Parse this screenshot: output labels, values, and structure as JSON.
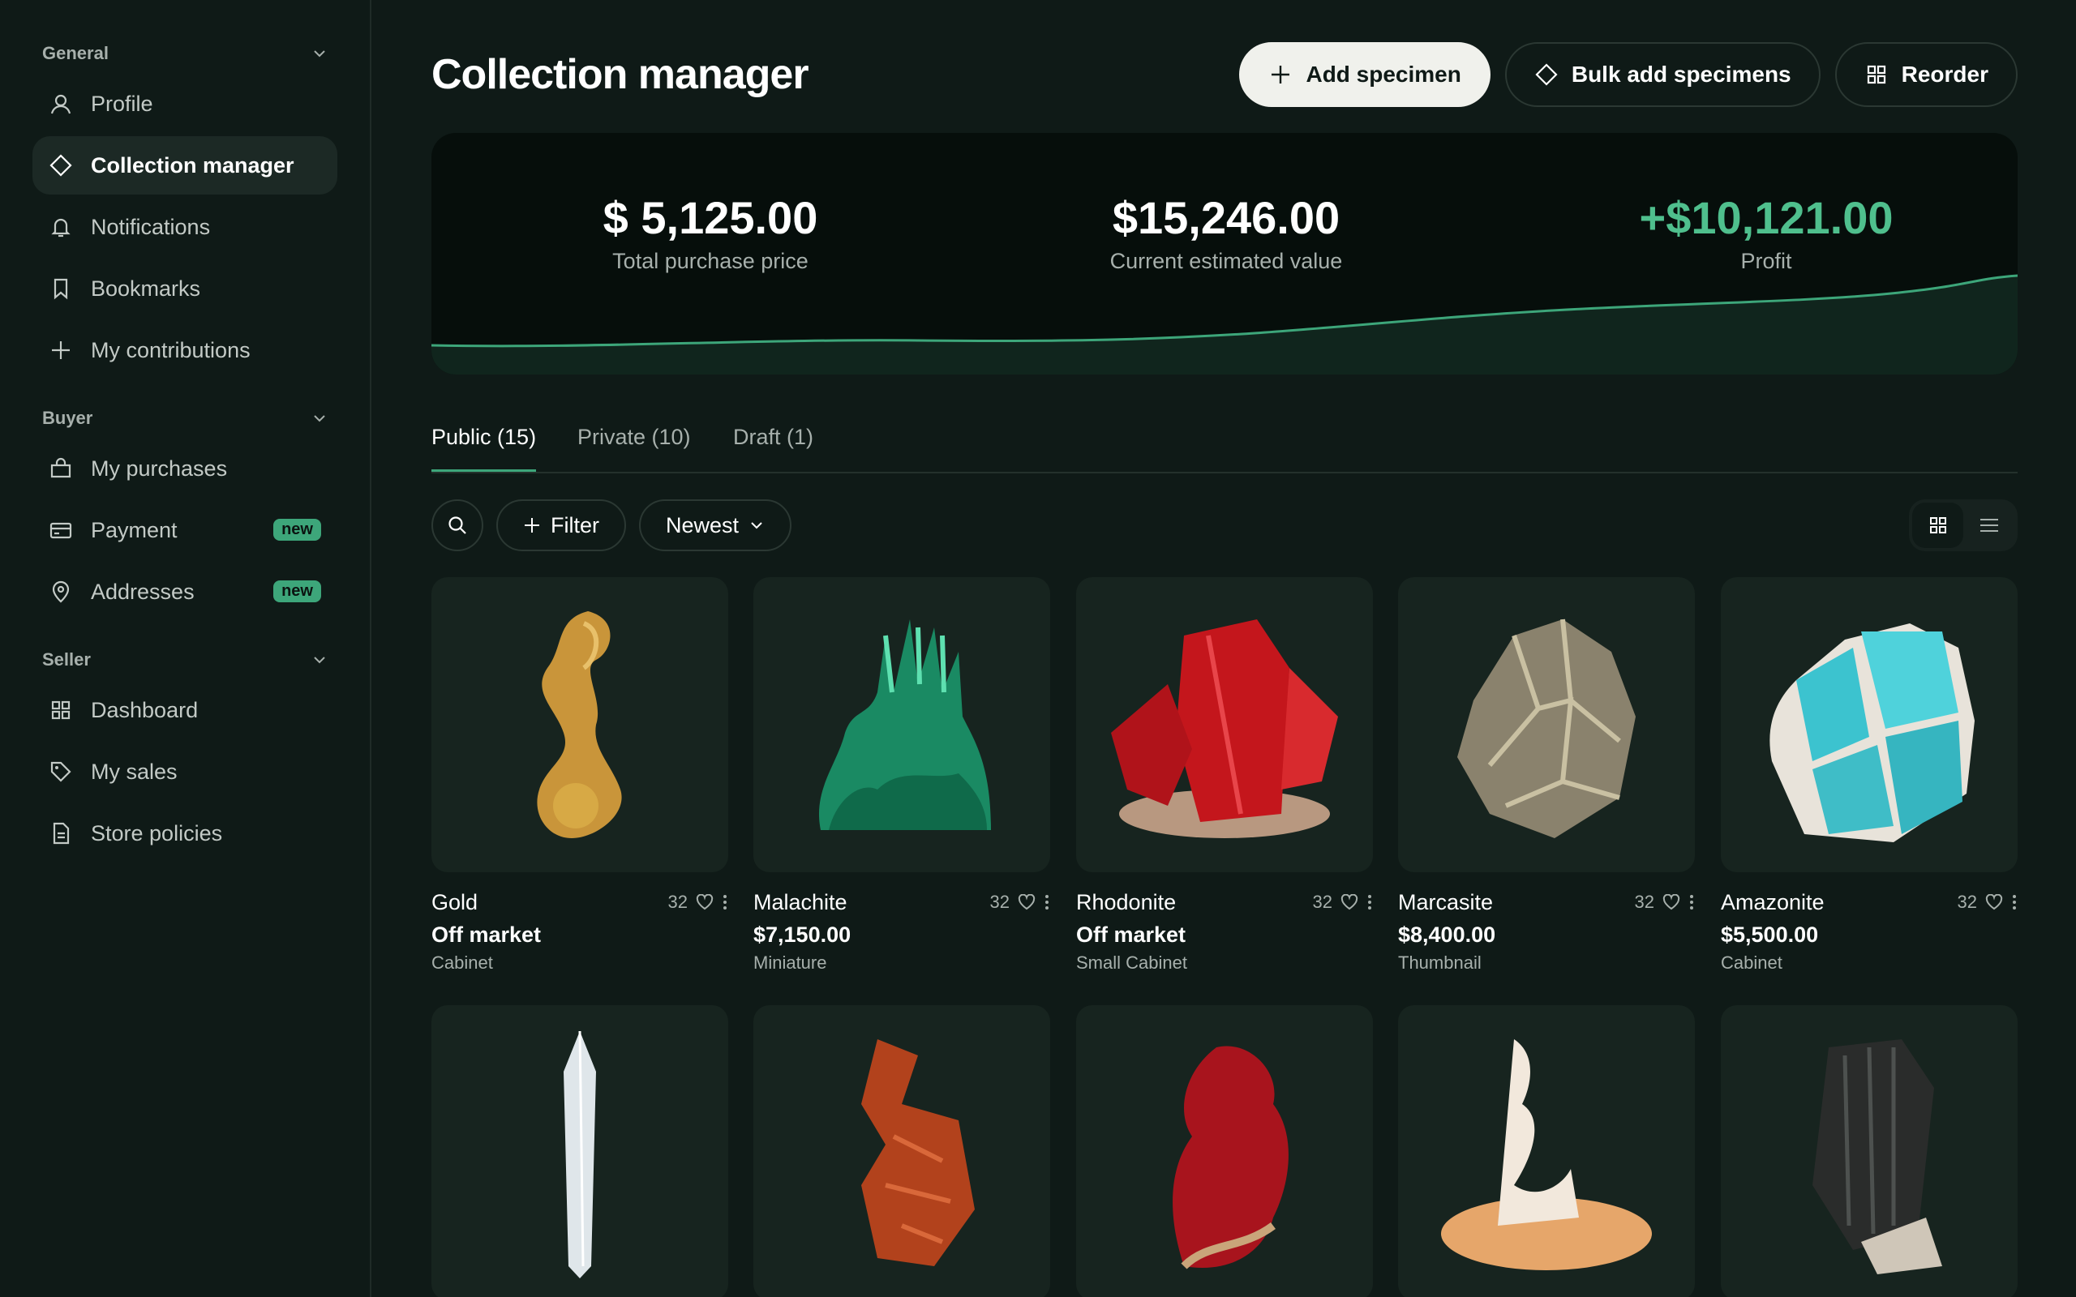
{
  "sidebar": {
    "sections": [
      {
        "title": "General",
        "items": [
          {
            "label": "Profile",
            "icon": "user-icon"
          },
          {
            "label": "Collection manager",
            "icon": "diamond-icon",
            "active": true
          },
          {
            "label": "Notifications",
            "icon": "bell-icon"
          },
          {
            "label": "Bookmarks",
            "icon": "bookmark-icon"
          },
          {
            "label": "My contributions",
            "icon": "plus-icon"
          }
        ]
      },
      {
        "title": "Buyer",
        "items": [
          {
            "label": "My purchases",
            "icon": "bag-icon"
          },
          {
            "label": "Payment",
            "icon": "card-icon",
            "badge": "new"
          },
          {
            "label": "Addresses",
            "icon": "pin-icon",
            "badge": "new"
          }
        ]
      },
      {
        "title": "Seller",
        "items": [
          {
            "label": "Dashboard",
            "icon": "grid-icon"
          },
          {
            "label": "My sales",
            "icon": "tag-icon"
          },
          {
            "label": "Store policies",
            "icon": "document-icon"
          }
        ]
      }
    ]
  },
  "header": {
    "title": "Collection manager",
    "add_label": "Add specimen",
    "bulk_label": "Bulk add specimens",
    "reorder_label": "Reorder"
  },
  "stats": {
    "purchase_value": "$ 5,125.00",
    "purchase_label": "Total purchase price",
    "current_value": "$15,246.00",
    "current_label": "Current estimated value",
    "profit_value": "+$10,121.00",
    "profit_label": "Profit",
    "accent_color": "#4fbf8d"
  },
  "tabs": [
    {
      "label": "Public (15)",
      "active": true
    },
    {
      "label": "Private (10)"
    },
    {
      "label": "Draft (1)"
    }
  ],
  "filters": {
    "filter_label": "Filter",
    "sort_label": "Newest"
  },
  "specimens": [
    {
      "name": "Gold",
      "likes": "32",
      "price": "Off market",
      "size": "Cabinet",
      "color": "#d9a93f"
    },
    {
      "name": "Malachite",
      "likes": "32",
      "price": "$7,150.00",
      "size": "Miniature",
      "color": "#1f9e72"
    },
    {
      "name": "Rhodonite",
      "likes": "32",
      "price": "Off market",
      "size": "Small Cabinet",
      "color": "#c4161c"
    },
    {
      "name": "Marcasite",
      "likes": "32",
      "price": "$8,400.00",
      "size": "Thumbnail",
      "color": "#a89f86"
    },
    {
      "name": "Amazonite",
      "likes": "32",
      "price": "$5,500.00",
      "size": "Cabinet",
      "color": "#3cc3cf"
    },
    {
      "color": "#dfe6ea"
    },
    {
      "color": "#b2421c"
    },
    {
      "color": "#a8141d"
    },
    {
      "color": "#e6a66a"
    },
    {
      "color": "#2a2c2b"
    }
  ]
}
